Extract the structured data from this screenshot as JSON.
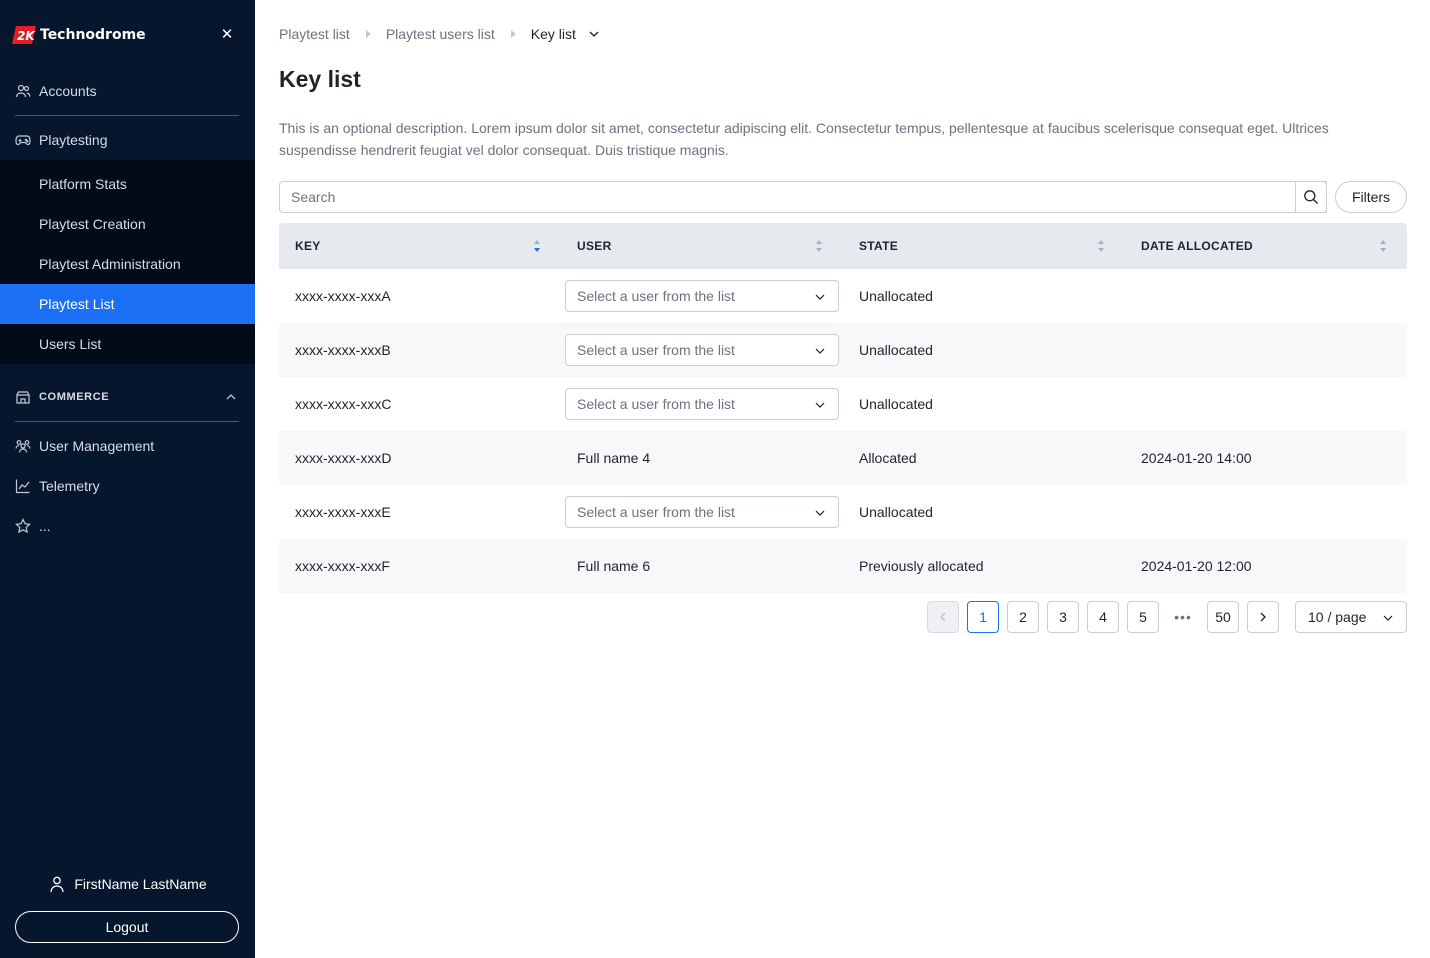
{
  "colors": {
    "sidebar_bg": "#06162d",
    "subnav_bg": "#020b18",
    "accent": "#1a6ff4",
    "brand_red": "#e41e26"
  },
  "sidebar": {
    "brand": {
      "logo_icon": "brand-2k-logo-icon",
      "name": "Technodrome"
    },
    "close_icon": "close-icon",
    "top_items": [
      {
        "label": "Accounts",
        "icon": "users-icon"
      },
      {
        "label": "Playtesting",
        "icon": "gamepad-icon"
      }
    ],
    "sub_items": [
      {
        "label": "Platform Stats",
        "active": false
      },
      {
        "label": "Playtest Creation",
        "active": false
      },
      {
        "label": "Playtest Administration",
        "active": false
      },
      {
        "label": "Playtest List",
        "active": true
      },
      {
        "label": "Users List",
        "active": false
      }
    ],
    "section": {
      "label": "COMMERCE",
      "icon": "store-icon",
      "expanded": true
    },
    "bottom_items": [
      {
        "label": "User Management",
        "icon": "user-group-icon"
      },
      {
        "label": "Telemetry",
        "icon": "chart-icon"
      },
      {
        "label": "...",
        "icon": "star-icon"
      }
    ],
    "user": {
      "name": "FirstName LastName",
      "icon": "user-icon"
    },
    "logout_label": "Logout"
  },
  "breadcrumb": [
    "Playtest list",
    "Playtest users list",
    "Key list"
  ],
  "page": {
    "title": "Key list",
    "description": "This is an optional description. Lorem ipsum dolor sit amet, consectetur adipiscing elit. Consectetur tempus, pellentesque at faucibus scelerisque consequat eget. Ultrices suspendisse hendrerit feugiat vel dolor consequat. Duis tristique magnis."
  },
  "search": {
    "placeholder": "Search",
    "value": ""
  },
  "filters_label": "Filters",
  "table": {
    "columns": [
      "KEY",
      "USER",
      "STATE",
      "DATE ALLOCATED"
    ],
    "sorted_column": "KEY",
    "sort_direction": "descending",
    "user_select_placeholder": "Select a user from the list",
    "rows": [
      {
        "key": "xxxx-xxxx-xxxA",
        "user": null,
        "state": "Unallocated",
        "date": ""
      },
      {
        "key": "xxxx-xxxx-xxxB",
        "user": null,
        "state": "Unallocated",
        "date": ""
      },
      {
        "key": "xxxx-xxxx-xxxC",
        "user": null,
        "state": "Unallocated",
        "date": ""
      },
      {
        "key": "xxxx-xxxx-xxxD",
        "user": "Full name 4",
        "state": "Allocated",
        "date": "2024-01-20 14:00"
      },
      {
        "key": "xxxx-xxxx-xxxE",
        "user": null,
        "state": "Unallocated",
        "date": ""
      },
      {
        "key": "xxxx-xxxx-xxxF",
        "user": "Full name 6",
        "state": "Previously allocated",
        "date": "2024-01-20 12:00"
      }
    ]
  },
  "pagination": {
    "pages": [
      "1",
      "2",
      "3",
      "4",
      "5"
    ],
    "ellipsis": "•••",
    "last_page": "50",
    "current": "1",
    "page_size": "10 / page"
  }
}
